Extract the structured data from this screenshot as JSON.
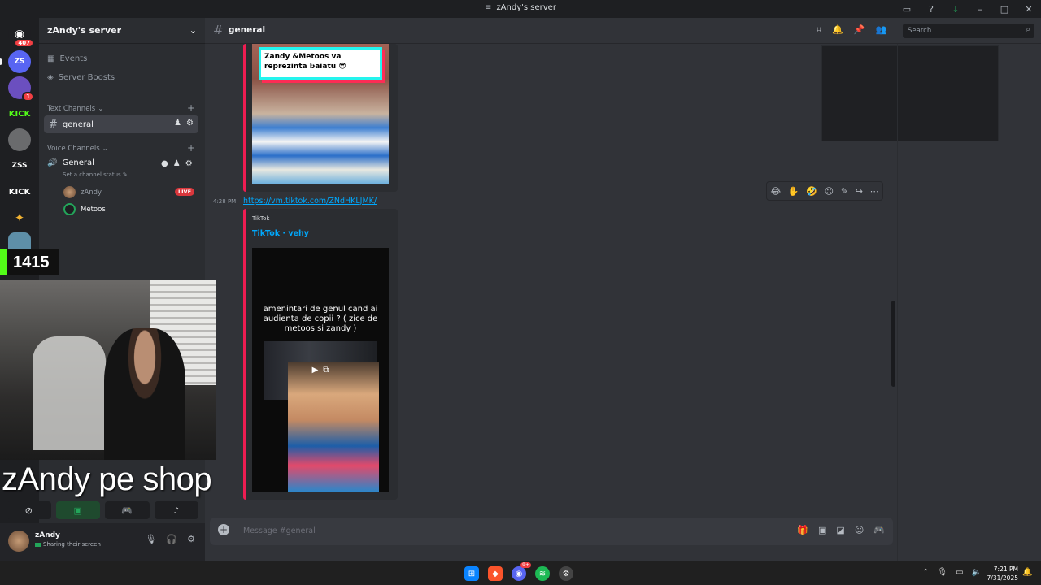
{
  "window": {
    "title": "zAndy's server"
  },
  "server": {
    "name": "zAndy's server"
  },
  "rail": {
    "home_badge": "407",
    "servers": [
      {
        "label": "ZS",
        "color": "#5865f2"
      },
      {
        "label": "",
        "color": "#6b4fbf",
        "badge": "1"
      },
      {
        "label": "KICK",
        "color": "#1e1f22"
      },
      {
        "label": "",
        "color": "#6a6b6d"
      },
      {
        "label": "ZSS",
        "color": "#1e1f22"
      },
      {
        "label": "KICK",
        "color": "#1e1f22"
      },
      {
        "label": "✦",
        "color": "#1e1f22"
      },
      {
        "label": "",
        "color": "#5e8fa8"
      }
    ]
  },
  "sidebar": {
    "events": "Events",
    "boosts": "Server Boosts",
    "text_category": "Text Channels",
    "active_channel": "general",
    "voice_category": "Voice Channels",
    "voice_channel": "General",
    "voice_status": "Set a channel status",
    "voice_users": [
      {
        "name": "zAndy",
        "live": "LIVE"
      },
      {
        "name": "Metoos"
      }
    ]
  },
  "header": {
    "channel": "general",
    "search_placeholder": "Search"
  },
  "messages": {
    "first_embed_caption": "Zandy &Metoos va reprezinta baiatu 😎",
    "timestamp": "4:28 PM",
    "link": "https://vm.tiktok.com/ZNdHKLJMK/",
    "provider": "TikTok",
    "embed_title": "TikTok · vehy",
    "video_text": "amenintari de genul cand ai audienta de copii ? ( zice de metoos si zandy )"
  },
  "composer": {
    "placeholder": "Message #general"
  },
  "overlay": {
    "counter": "1415",
    "caption": "zAndy pe shop"
  },
  "user_panel": {
    "name": "zAndy",
    "status": "Sharing their screen"
  },
  "taskbar": {
    "time": "7:21 PM",
    "date": "7/31/2025",
    "discord_badge": "9+"
  }
}
